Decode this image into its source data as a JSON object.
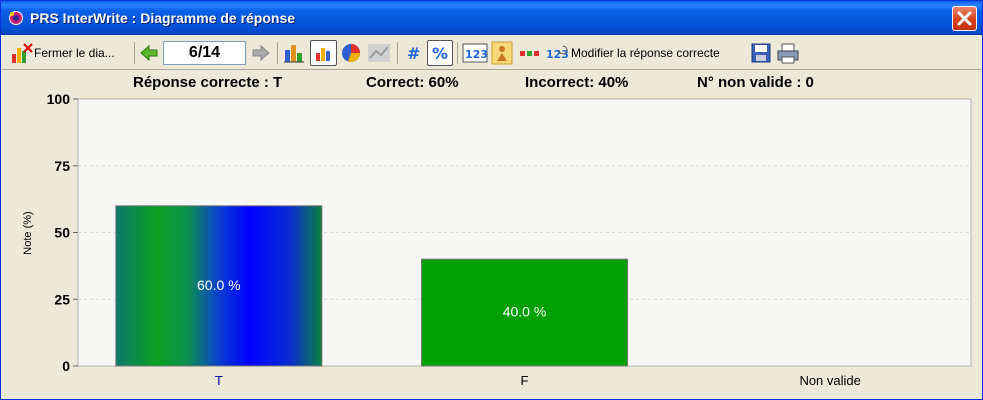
{
  "window": {
    "title": "PRS InterWrite : Diagramme de réponse"
  },
  "toolbar": {
    "close_chart_label": "Fermer le dia...",
    "page_indicator": "6/14",
    "modify_answer_label": "Modifier la réponse correcte",
    "icons": [
      "close-chart-icon",
      "back-arrow-icon",
      "forward-arrow-icon",
      "bar-chart-icon",
      "bar-chart-3d-icon",
      "pie-chart-icon",
      "line-chart-icon",
      "count-icon",
      "percent-icon",
      "numbers-123-icon",
      "teacher-icon",
      "answer-bars-icon",
      "modify-123-icon",
      "save-icon",
      "print-icon"
    ]
  },
  "summary": {
    "correct_answer": "Réponse correcte : T",
    "correct": "Correct: 60%",
    "incorrect": "Incorrect: 40%",
    "invalid": "N° non valide : 0"
  },
  "colors": {
    "accent_green": "#00a000",
    "accent_blue": "#0000ff",
    "correct_label_color": "#00009c"
  },
  "chart_data": {
    "type": "bar",
    "categories": [
      "T",
      "F",
      "Non valide"
    ],
    "values": [
      60,
      40,
      0
    ],
    "data_labels": [
      "60.0 %",
      "40.0 %",
      ""
    ],
    "ylabel": "Note (%)",
    "xlabel": "",
    "ylim": [
      0,
      100
    ],
    "yticks": [
      "0",
      "25",
      "50",
      "75",
      "100"
    ],
    "grid": true
  }
}
